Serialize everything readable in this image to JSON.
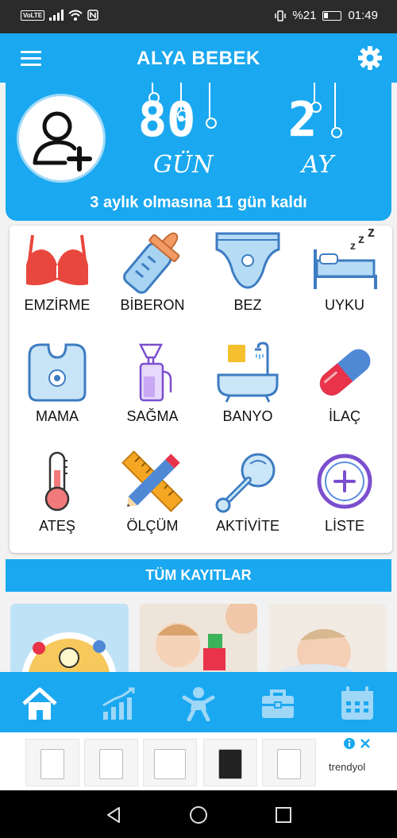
{
  "status_bar": {
    "volte": "VoLTE",
    "battery_percent": "%21",
    "time": "01:49"
  },
  "app_bar": {
    "title": "ALYA BEBEK",
    "menu_icon": "hamburger-menu-icon",
    "settings_icon": "gear-icon"
  },
  "baby": {
    "avatar_icon": "add-user-icon",
    "days": "80",
    "days_unit": "GÜN",
    "months": "2",
    "months_unit": "AY",
    "countdown": "3 aylık olmasına 11 gün kaldı"
  },
  "actions": [
    {
      "label": "EMZİRME",
      "icon": "bra-icon"
    },
    {
      "label": "BİBERON",
      "icon": "baby-bottle-icon"
    },
    {
      "label": "BEZ",
      "icon": "diaper-icon"
    },
    {
      "label": "UYKU",
      "icon": "bed-sleep-icon"
    },
    {
      "label": "MAMA",
      "icon": "bib-icon"
    },
    {
      "label": "SAĞMA",
      "icon": "breast-pump-icon"
    },
    {
      "label": "BANYO",
      "icon": "bathtub-icon"
    },
    {
      "label": "İLAÇ",
      "icon": "pill-capsule-icon"
    },
    {
      "label": "ATEŞ",
      "icon": "thermometer-icon"
    },
    {
      "label": "ÖLÇÜM",
      "icon": "ruler-pencil-icon"
    },
    {
      "label": "AKTİVİTE",
      "icon": "rattle-icon"
    },
    {
      "label": "LİSTE",
      "icon": "plus-circle-icon"
    }
  ],
  "all_records": {
    "label": "TÜM KAYITLAR"
  },
  "bottom_nav": [
    {
      "icon": "home-icon",
      "active": true
    },
    {
      "icon": "growth-chart-icon",
      "active": false
    },
    {
      "icon": "baby-icon",
      "active": false
    },
    {
      "icon": "briefcase-icon",
      "active": false
    },
    {
      "icon": "calendar-icon",
      "active": false
    }
  ],
  "ad": {
    "brand": "trendyol"
  },
  "colors": {
    "primary": "#1aa8f0",
    "status_bar": "#2b2b2b"
  }
}
